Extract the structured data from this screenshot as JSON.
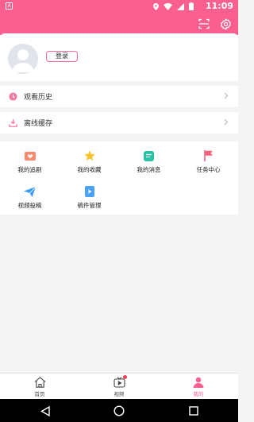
{
  "status_bar": {
    "time": "11:09",
    "app_indicator": "A",
    "icons": [
      "location-icon",
      "wifi-icon",
      "signal-icon",
      "battery-icon"
    ]
  },
  "header": {
    "scan_icon": "scan-icon",
    "settings_icon": "settings-icon"
  },
  "profile": {
    "login_label": "登录"
  },
  "menu": [
    {
      "label": "观看历史",
      "icon": "clock-icon"
    },
    {
      "label": "离线缓存",
      "icon": "download-icon"
    }
  ],
  "grid": [
    {
      "label": "我的追剧",
      "icon": "heart-tv-icon",
      "color": "#f78a6f"
    },
    {
      "label": "我的收藏",
      "icon": "star-icon",
      "color": "#f7c531"
    },
    {
      "label": "我的消息",
      "icon": "message-icon",
      "color": "#27c3a6"
    },
    {
      "label": "任务中心",
      "icon": "flag-icon",
      "color": "#f45f7b"
    },
    {
      "label": "视频投稿",
      "icon": "send-icon",
      "color": "#3a9df2"
    },
    {
      "label": "稿件管理",
      "icon": "video-file-icon",
      "color": "#4aa3f5"
    }
  ],
  "tabs": [
    {
      "label": "首页",
      "icon": "home-icon"
    },
    {
      "label": "视频",
      "icon": "tv-icon"
    },
    {
      "label": "我的",
      "icon": "person-icon"
    }
  ],
  "colors": {
    "brand": "#fb5f8f",
    "background": "#f4f4f4"
  }
}
